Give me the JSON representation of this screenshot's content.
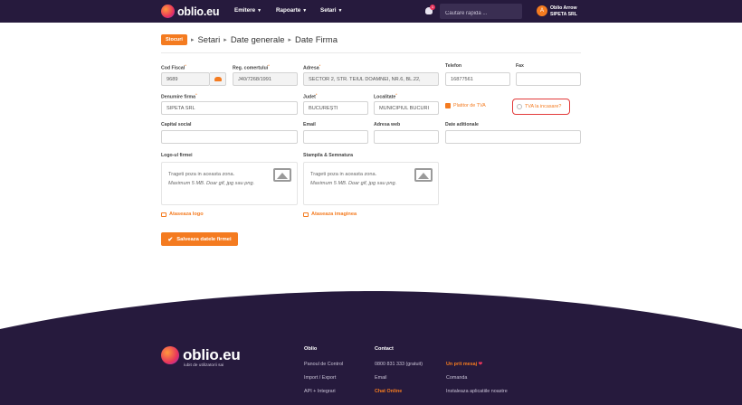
{
  "header": {
    "logo_text": "oblio.eu",
    "nav": [
      {
        "label": "Emitere"
      },
      {
        "label": "Rapoarte"
      },
      {
        "label": "Setari"
      }
    ],
    "notification_count": "1",
    "search_placeholder": "Cautare rapida ...",
    "avatar_initial": "A",
    "user_name": "Oblio Arrow",
    "company_name": "SIPETA SRL"
  },
  "breadcrumb": {
    "badge": "Stocuri",
    "items": [
      "Setari",
      "Date generale",
      "Date Firma"
    ]
  },
  "form": {
    "cod_fiscal": {
      "label": "Cod Fiscal",
      "value": "9689"
    },
    "reg_comertului": {
      "label": "Reg. comertului",
      "value": "J40/7268/1991"
    },
    "adresa": {
      "label": "Adresa",
      "value": "SECTOR 2,  STR. TEIUL DOAMNEI,  NR.6,  BL.22,"
    },
    "telefon": {
      "label": "Telefon",
      "value": "16877561"
    },
    "fax": {
      "label": "Fax",
      "value": ""
    },
    "denumire": {
      "label": "Denumire firma",
      "value": "SIPETA SRL"
    },
    "judet": {
      "label": "Judet",
      "value": "BUCUREȘTI"
    },
    "localitate": {
      "label": "Localitate",
      "value": "MUNICIPIUL BUCURI"
    },
    "platitor_tva": {
      "label": "Platitor de TVA",
      "checked": true
    },
    "tva_incasare": {
      "label": "TVA la incasare?",
      "checked": false
    },
    "capital": {
      "label": "Capital social",
      "value": ""
    },
    "email": {
      "label": "Email",
      "value": ""
    },
    "web": {
      "label": "Adresa web",
      "value": ""
    },
    "date_aditionale": {
      "label": "Date aditionale",
      "value": ""
    },
    "logo": {
      "label": "Logo-ul firmei",
      "drop_line1": "Trageti poza in aceasta zona.",
      "drop_line2": "Maximum 5 MB. Doar gif, jpg sau png.",
      "attach_label": "Ataseaza logo"
    },
    "stampila": {
      "label": "Stampila & Semnatura",
      "drop_line1": "Trageti poza in aceasta zona.",
      "drop_line2": "Maximum 5 MB. Doar gif, jpg sau png.",
      "attach_label": "Ataseaza imaginea"
    },
    "save_label": "Salveaza datele firmei"
  },
  "footer": {
    "logo_text": "oblio.eu",
    "tagline": "iubit de utilizatorii sai",
    "col_oblio": {
      "title": "Oblio",
      "links": [
        "Panoul de Control",
        "Import / Export",
        "API + Integrari"
      ]
    },
    "col_contact": {
      "title": "Contact",
      "links": [
        "0800 831 333 (gratuit)",
        "Email",
        "Chat Online"
      ]
    },
    "col_extra": {
      "links": [
        "Un prit mesaj",
        "Comanda",
        "Instaleaza aplicatiile noastre"
      ]
    }
  },
  "colors": {
    "brand_dark": "#261a3d",
    "accent": "#f47b20",
    "highlight_border": "#e23a3a"
  }
}
